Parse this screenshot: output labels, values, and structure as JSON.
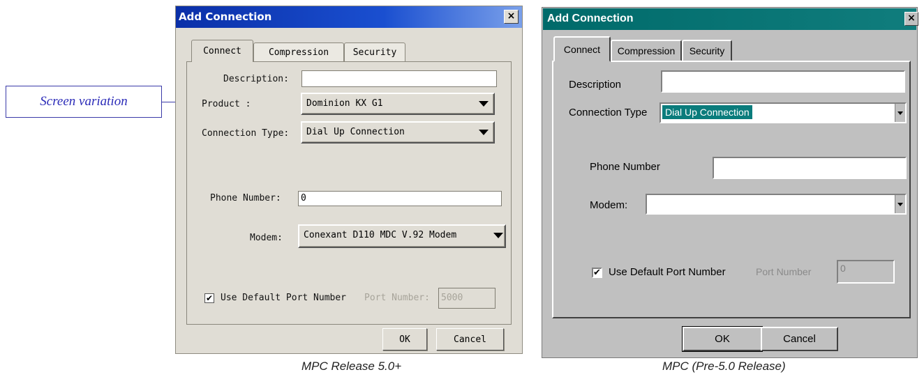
{
  "callout": {
    "text": "Screen variation"
  },
  "captions": {
    "new": "MPC Release 5.0+",
    "old": "MPC (Pre-5.0 Release)"
  },
  "dialog_new": {
    "title": "Add Connection",
    "close_label": "×",
    "tabs": [
      "Connect",
      "Compression",
      "Security"
    ],
    "description_label": "Description:",
    "description_value": "",
    "product_label": "Product :",
    "product_value": "Dominion KX G1",
    "connection_type_label": "Connection Type:",
    "connection_type_value": "Dial Up Connection",
    "phone_label": "Phone Number:",
    "phone_value": "0",
    "modem_label": "Modem:",
    "modem_value": "Conexant D110 MDC V.92 Modem",
    "use_default_port_label": "Use Default Port Number",
    "use_default_port_checked": "✔",
    "port_number_label": "Port Number:",
    "port_number_value": "5000",
    "ok_label": "OK",
    "cancel_label": "Cancel"
  },
  "dialog_old": {
    "title": "Add Connection",
    "close_label": "×",
    "tabs": [
      "Connect",
      "Compression",
      "Security"
    ],
    "description_label": "Description",
    "description_value": "",
    "connection_type_label": "Connection Type",
    "connection_type_value": "Dial Up Connection",
    "phone_label": "Phone Number",
    "phone_value": "",
    "modem_label": "Modem:",
    "modem_value": "",
    "use_default_port_label": "Use Default Port Number",
    "use_default_port_checked": "✔",
    "port_number_label": "Port Number",
    "port_number_value": "0",
    "ok_label": "OK",
    "cancel_label": "Cancel"
  }
}
